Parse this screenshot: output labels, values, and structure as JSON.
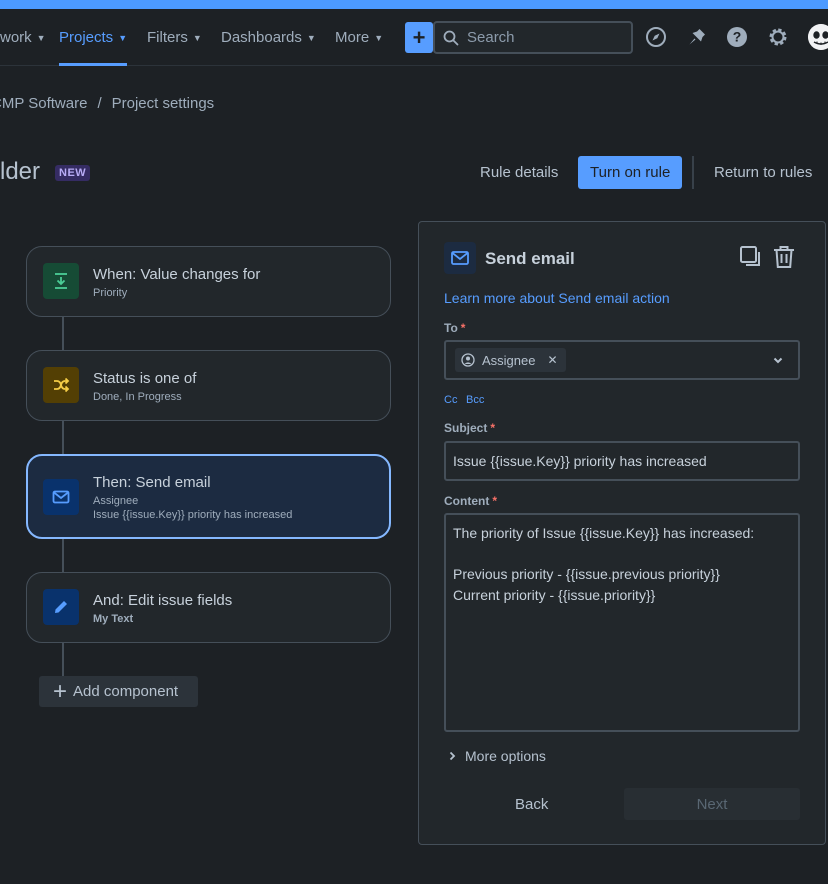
{
  "nav": {
    "items": [
      {
        "label": "work",
        "active": false
      },
      {
        "label": "Projects",
        "active": true
      },
      {
        "label": "Filters",
        "active": false
      },
      {
        "label": "Dashboards",
        "active": false
      },
      {
        "label": "More",
        "active": false
      }
    ],
    "create_label": "+",
    "search_placeholder": "Search",
    "icons": [
      "compass-icon",
      "notification-icon",
      "help-icon",
      "settings-icon"
    ],
    "accent_color": "#579dff"
  },
  "breadcrumb": {
    "project": "CMP Software",
    "separator": "/",
    "current": "Project settings"
  },
  "header": {
    "title": "lder",
    "badge": "NEW",
    "rule_details": "Rule details",
    "turn_on": "Turn on rule",
    "return": "Return to rules"
  },
  "rule": {
    "components": [
      {
        "icon": "download-icon",
        "title": "When: Value changes for",
        "lines": [
          "Priority"
        ]
      },
      {
        "icon": "shuffle-icon",
        "title": "Status is one of",
        "lines": [
          "Done, In Progress"
        ]
      },
      {
        "icon": "mail-icon",
        "title": "Then: Send email",
        "lines": [
          "Assignee",
          "Issue {{issue.Key}} priority has increased"
        ],
        "selected": true
      },
      {
        "icon": "edit-icon",
        "title": "And: Edit issue fields",
        "lines": [
          "My Text"
        ]
      }
    ],
    "add_label": "Add component"
  },
  "panel": {
    "title": "Send email",
    "learn_more": "Learn more about Send email action",
    "to_label": "To",
    "to_chip": "Assignee",
    "cc": "Cc",
    "bcc": "Bcc",
    "subject_label": "Subject",
    "subject_value": "Issue {{issue.Key}} priority has increased",
    "content_label": "Content",
    "content_value": "The priority of Issue {{issue.Key}} has increased:\n\nPrevious priority - {{issue.previous priority}}\nCurrent priority - {{issue.priority}}",
    "more_options": "More options",
    "back": "Back",
    "next": "Next",
    "required_mark": "*"
  }
}
